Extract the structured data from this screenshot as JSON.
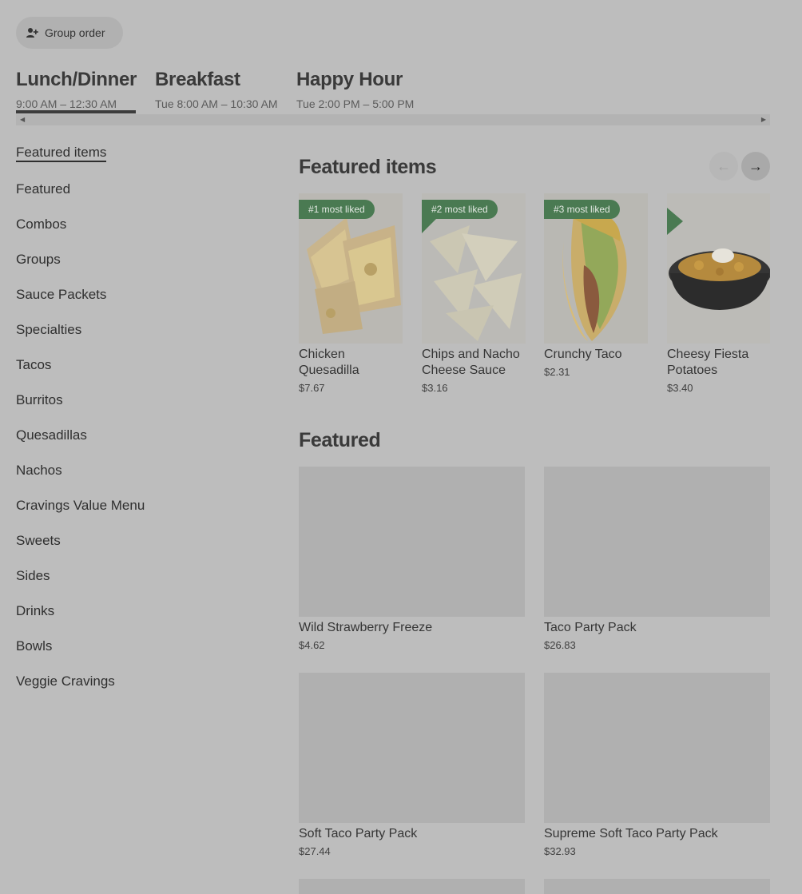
{
  "group_order": {
    "label": "Group order",
    "icon": "person-add-icon"
  },
  "menus": [
    {
      "title": "Lunch/Dinner",
      "hours": "9:00 AM – 12:30 AM"
    },
    {
      "title": "Breakfast",
      "hours": "Tue 8:00 AM – 10:30 AM"
    },
    {
      "title": "Happy Hour",
      "hours": "Tue 2:00 PM – 5:00 PM"
    }
  ],
  "sidebar": {
    "items": [
      {
        "label": "Featured items"
      },
      {
        "label": "Featured"
      },
      {
        "label": "Combos"
      },
      {
        "label": "Groups"
      },
      {
        "label": "Sauce Packets"
      },
      {
        "label": "Specialties"
      },
      {
        "label": "Tacos"
      },
      {
        "label": "Burritos"
      },
      {
        "label": "Quesadillas"
      },
      {
        "label": "Nachos"
      },
      {
        "label": "Cravings Value Menu"
      },
      {
        "label": "Sweets"
      },
      {
        "label": "Sides"
      },
      {
        "label": "Drinks"
      },
      {
        "label": "Bowls"
      },
      {
        "label": "Veggie Cravings"
      }
    ]
  },
  "featured_items": {
    "title": "Featured items",
    "cards": [
      {
        "badge": "#1 most liked",
        "name": "Chicken Quesadilla",
        "price": "$7.67"
      },
      {
        "badge": "#2 most liked",
        "name": "Chips and Nacho Cheese Sauce",
        "price": "$3.16"
      },
      {
        "badge": "#3 most liked",
        "name": "Crunchy Taco",
        "price": "$2.31"
      },
      {
        "badge": "",
        "name": "Cheesy Fiesta Potatoes",
        "price": "$3.40"
      }
    ]
  },
  "featured": {
    "title": "Featured",
    "items": [
      {
        "name": "Wild Strawberry Freeze",
        "price": "$4.62"
      },
      {
        "name": "Taco Party Pack",
        "price": "$26.83"
      },
      {
        "name": "Soft Taco Party Pack",
        "price": "$27.44"
      },
      {
        "name": "Supreme Soft Taco Party Pack",
        "price": "$32.93"
      }
    ]
  },
  "colors": {
    "badge": "#4a7a52",
    "background": "#bdbdbd"
  }
}
